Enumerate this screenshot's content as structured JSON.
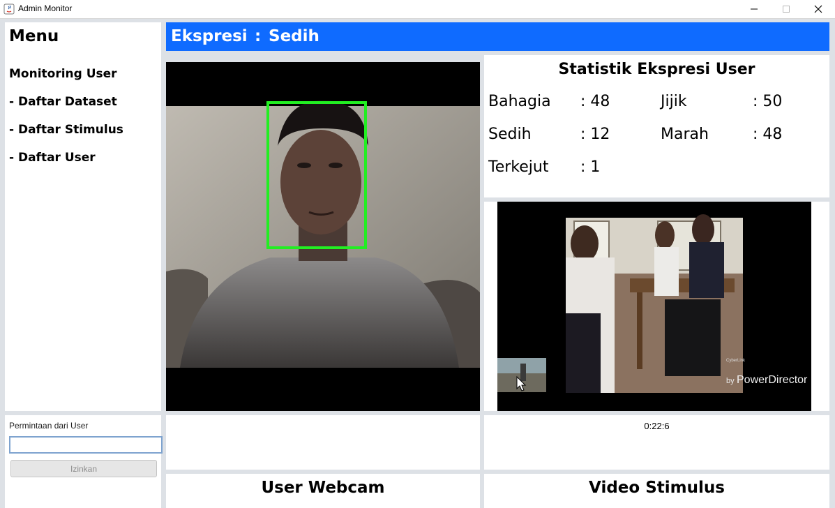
{
  "window": {
    "title": "Admin Monitor"
  },
  "menu": {
    "title": "Menu",
    "items": [
      {
        "label": "Monitoring User"
      },
      {
        "label": "- Daftar Dataset"
      },
      {
        "label": "- Daftar Stimulus"
      },
      {
        "label": "- Daftar User"
      }
    ]
  },
  "request": {
    "label": "Permintaan dari User",
    "value": "",
    "button_label": "Izinkan"
  },
  "expression": {
    "label": "Ekspresi",
    "colon": ":",
    "value": "Sedih"
  },
  "stats": {
    "title": "Statistik Ekspresi User",
    "items": [
      {
        "label": "Bahagia",
        "value": ": 48"
      },
      {
        "label": "Jijik",
        "value": ": 50"
      },
      {
        "label": "Sedih",
        "value": ": 12"
      },
      {
        "label": "Marah",
        "value": ": 48"
      },
      {
        "label": "Terkejut",
        "value": ": 1"
      }
    ]
  },
  "stimulus": {
    "timer": "0:22:6",
    "watermark_small": "CyberLink",
    "watermark_by": "by",
    "watermark_brand": "PowerDirector"
  },
  "captions": {
    "webcam": "User Webcam",
    "stimulus": "Video Stimulus"
  },
  "colors": {
    "header_bar": "#0f6bff",
    "face_box": "#22ee22",
    "background": "#dde1e6"
  }
}
